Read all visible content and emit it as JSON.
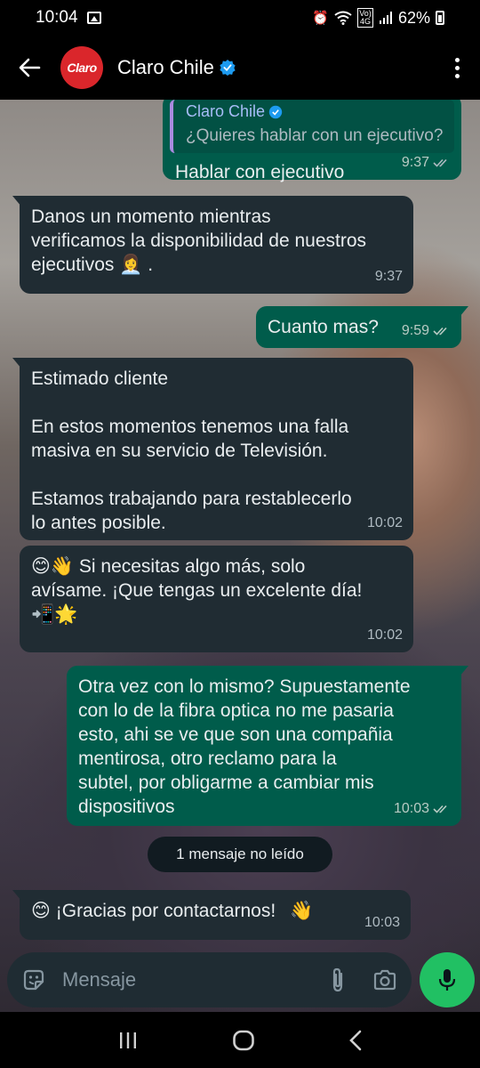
{
  "status_bar": {
    "time": "10:04",
    "battery": "62%",
    "network": "Vo) 4G"
  },
  "header": {
    "avatar_text": "Claro",
    "contact_name": "Claro Chile"
  },
  "messages": [
    {
      "quote_name": "Claro Chile",
      "quote_text": "¿Quieres hablar con un ejecutivo?",
      "text": "Hablar con ejecutivo",
      "time": "9:37"
    },
    {
      "text_line1": "Danos un momento mientras",
      "text_line2": "verificamos la disponibilidad de nuestros",
      "text_line3": "ejecutivos",
      "emoji": "👩‍💼",
      "text_after": ".",
      "time": "9:37"
    },
    {
      "text": "Cuanto mas?",
      "time": "9:59"
    },
    {
      "p1": "Estimado cliente",
      "p2_line1": "En estos momentos tenemos una falla",
      "p2_line2": "masiva en su servicio de Televisión.",
      "p3_line1": "Estamos trabajando para restablecerlo",
      "p3_line2": "lo antes posible.",
      "time": "10:02"
    },
    {
      "emoji_start": "😊👋",
      "text_line1": " Si necesitas algo más, solo",
      "text_line2": "avísame. ¡Que tengas un excelente día!",
      "emoji_end": "📲🌟",
      "time": "10:02"
    },
    {
      "line1": "Otra vez con lo mismo? Supuestamente",
      "line2": "con lo de la fibra optica no me pasaria",
      "line3": "esto, ahi se ve que son una compañia",
      "line4": "mentirosa, otro reclamo para la",
      "line5": "subtel, por obligarme a cambiar mis",
      "line6": "dispositivos",
      "time": "10:03"
    },
    {
      "emoji_start": "😊",
      "text": " ¡Gracias por contactarnos!",
      "emoji_end": "👋",
      "time": "10:03"
    }
  ],
  "unread_label": "1 mensaje no leído",
  "input": {
    "placeholder": "Mensaje"
  },
  "colors": {
    "incoming_bubble": "#202c33",
    "outgoing_bubble": "#005c4b",
    "mic_button": "#21c063",
    "brand_red": "#da262b",
    "verified_blue": "#1d9bf0"
  }
}
